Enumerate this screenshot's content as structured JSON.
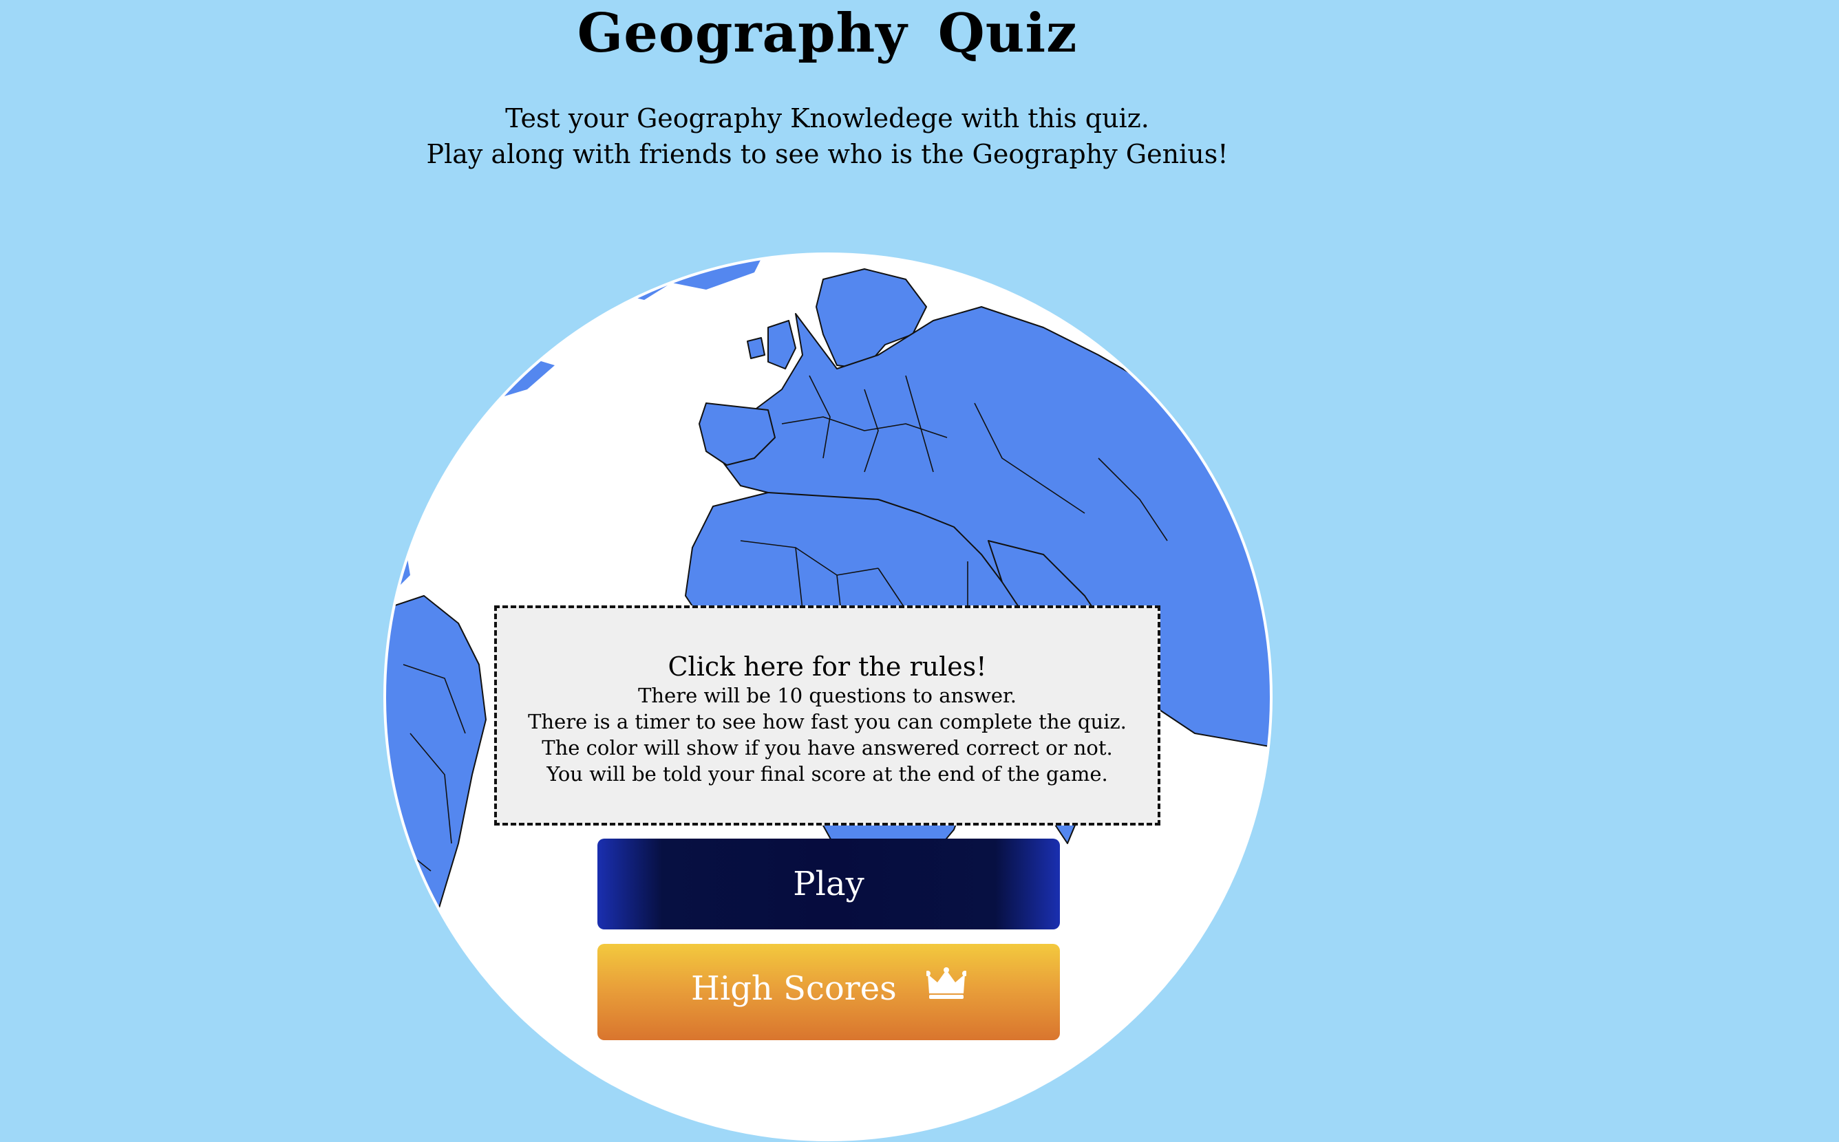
{
  "header": {
    "title": "Geography  Quiz"
  },
  "intro": {
    "line1": "Test your Geography Knowledege with this quiz.",
    "line2": "Play along with friends to see who is the Geography Genius!"
  },
  "rules": {
    "heading": "Click here for the rules!",
    "lines": [
      "There will be 10 questions to answer.",
      "There is a timer to see how fast you can complete the quiz.",
      "The color will show if you have answered correct or not.",
      "You will be told your final score at the end of the game."
    ]
  },
  "buttons": {
    "play_label": "Play",
    "high_scores_label": "High Scores",
    "high_scores_icon": "crown-icon"
  },
  "colors": {
    "background": "#9fd8f8",
    "land": "#5487ef",
    "ocean": "#ffffff",
    "play_button": "#060c3e",
    "high_scores_top": "#f3c93e",
    "high_scores_bottom": "#d9752e"
  }
}
